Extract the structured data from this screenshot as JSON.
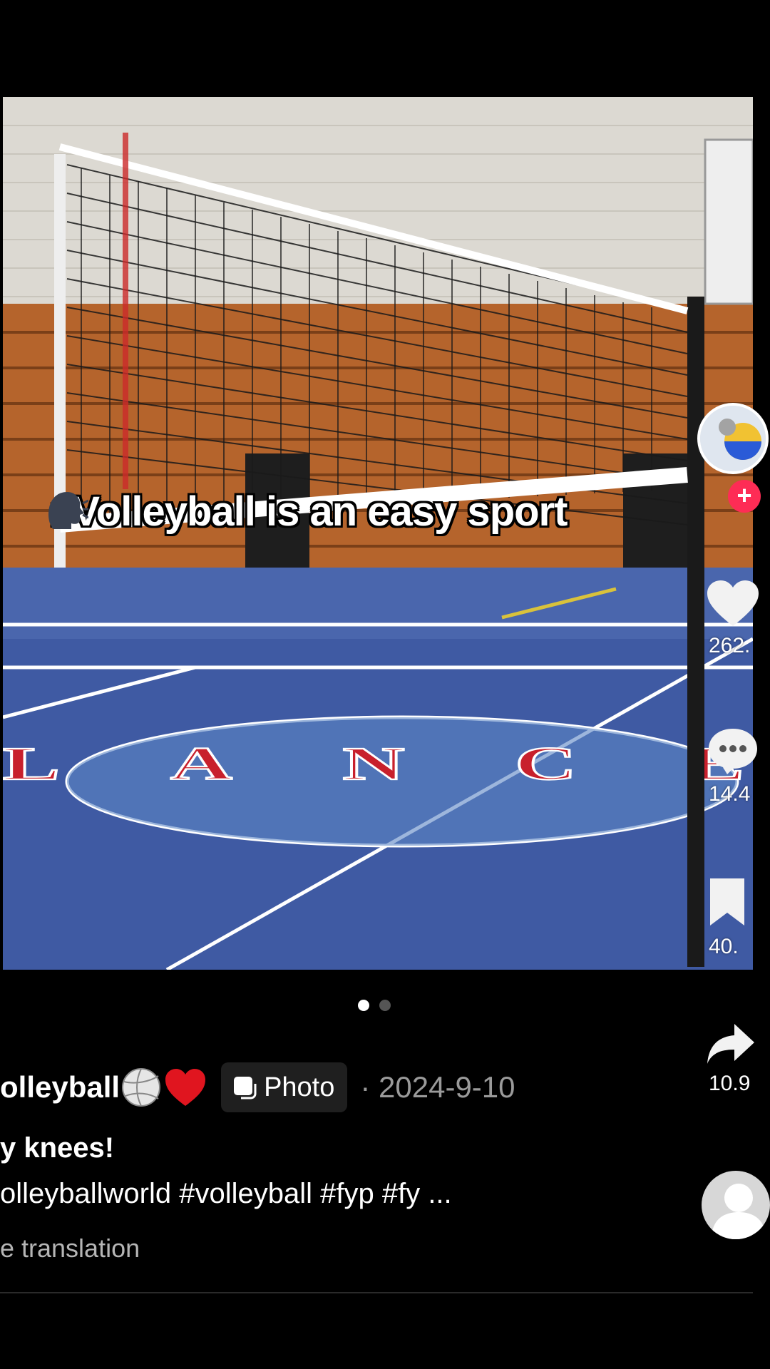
{
  "post": {
    "overlay_text": ": Volleyball is an easy sport",
    "author": "olleyball",
    "badge_label": "Photo",
    "date_text": "· 2024-9-10",
    "title": "y knees!",
    "hashtags": "olleyballworld #volleyball #fyp #fy ...",
    "translation_label": "e translation",
    "floor_logo_text": "LANCE"
  },
  "rail": {
    "likes": "262.",
    "comments": "14.4",
    "saves": "40.",
    "shares": "10.9"
  },
  "carousel": {
    "count": 2,
    "active_index": 0
  },
  "colors": {
    "follow_red": "#fe2c55",
    "court_blue": "#3f5aa3",
    "wood": "#b5642c"
  }
}
